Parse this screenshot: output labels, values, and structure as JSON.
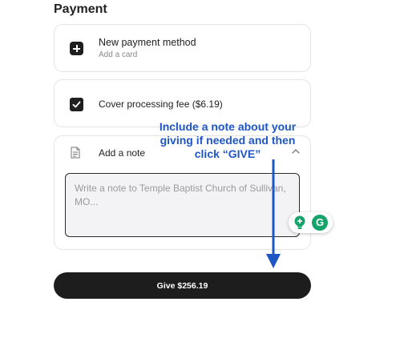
{
  "payment": {
    "title": "Payment",
    "new_method": {
      "title": "New payment method",
      "subtitle": "Add a card",
      "icon": "plus-icon"
    },
    "cover_fee": {
      "label": "Cover processing fee ($6.19)",
      "checked": true,
      "icon": "checkbox-checked-icon"
    },
    "note": {
      "label": "Add a note",
      "icon": "note-icon",
      "expanded": true,
      "placeholder": "Write a note to Temple Baptist Church of Sullivan, MO...",
      "value": ""
    },
    "give_button": {
      "label": "Give $256.19"
    }
  },
  "annotation": {
    "text": "Include a note about your giving if needed and then click “GIVE”",
    "color": "#1f56c6"
  },
  "grammarly_widget": {
    "letter": "G",
    "color": "#15a36b"
  }
}
